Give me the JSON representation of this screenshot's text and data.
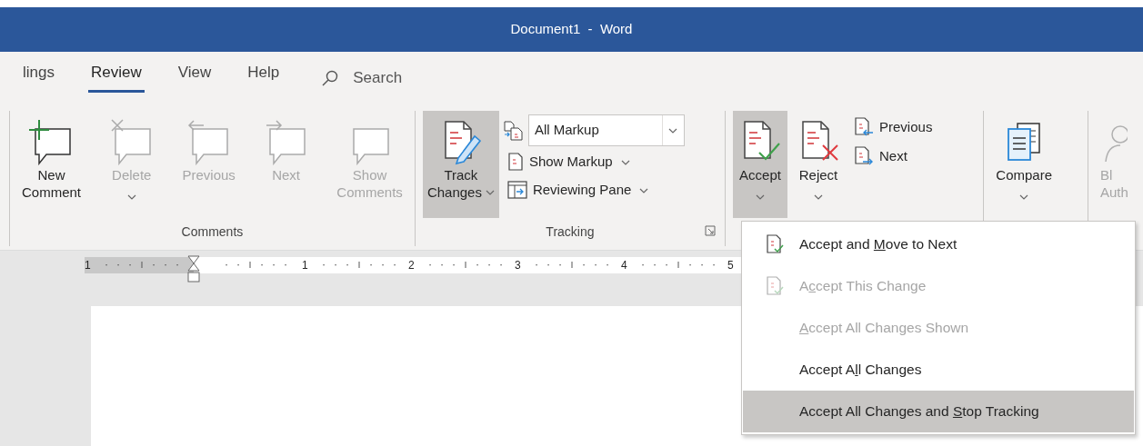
{
  "window": {
    "title": "Document1  -  Word"
  },
  "tabs": [
    {
      "label": "lings",
      "selected": false
    },
    {
      "label": "Review",
      "selected": true
    },
    {
      "label": "View",
      "selected": false
    },
    {
      "label": "Help",
      "selected": false
    }
  ],
  "search": {
    "placeholder": "Search"
  },
  "ribbon": {
    "groups": [
      {
        "label": "Comments",
        "dialog_launcher": false,
        "controls": [
          {
            "kind": "large",
            "label": [
              "New",
              "Comment"
            ],
            "disabled": false,
            "pressed": false,
            "dropdown": false
          },
          {
            "kind": "large",
            "label": [
              "Delete"
            ],
            "disabled": true,
            "pressed": false,
            "dropdown": true
          },
          {
            "kind": "large",
            "label": [
              "Previous"
            ],
            "disabled": true,
            "pressed": false,
            "dropdown": false
          },
          {
            "kind": "large",
            "label": [
              "Next"
            ],
            "disabled": true,
            "pressed": false,
            "dropdown": false
          },
          {
            "kind": "large",
            "label": [
              "Show",
              "Comments"
            ],
            "disabled": true,
            "pressed": false,
            "dropdown": false
          }
        ]
      },
      {
        "label": "Tracking",
        "dialog_launcher": true,
        "controls": [
          {
            "kind": "large",
            "label": [
              "Track",
              "Changes"
            ],
            "disabled": false,
            "pressed": true,
            "dropdown": true
          },
          {
            "kind": "stack",
            "items": [
              {
                "kind": "combo",
                "value": "All Markup"
              },
              {
                "kind": "small",
                "label": "Show Markup",
                "dropdown": true
              },
              {
                "kind": "small",
                "label": "Reviewing Pane",
                "dropdown": true
              }
            ]
          }
        ]
      },
      {
        "dialog_launcher": false,
        "controls": [
          {
            "kind": "large",
            "label": [
              "Accept"
            ],
            "disabled": false,
            "pressed": true,
            "dropdown": true
          },
          {
            "kind": "large",
            "label": [
              "Reject"
            ],
            "disabled": false,
            "pressed": false,
            "dropdown": true
          },
          {
            "kind": "stack",
            "items": [
              {
                "kind": "small",
                "label": "Previous",
                "dropdown": false
              },
              {
                "kind": "small",
                "label": "Next",
                "dropdown": false
              }
            ]
          }
        ]
      },
      {
        "dialog_launcher": false,
        "controls": [
          {
            "kind": "large",
            "label": [
              "Compare"
            ],
            "disabled": false,
            "pressed": false,
            "dropdown": true
          }
        ]
      },
      {
        "dialog_launcher": false,
        "controls": [
          {
            "kind": "large",
            "label": [
              "Bl",
              "Auth"
            ],
            "disabled": true,
            "pressed": false,
            "dropdown": false
          }
        ]
      }
    ]
  },
  "ruler": {
    "labels": [
      "1",
      "1",
      "2",
      "3",
      "4",
      "5"
    ]
  },
  "menu": {
    "items": [
      {
        "label": {
          "before": "Accept and ",
          "key": "M",
          "after": "ove to Next"
        },
        "has_icon": true,
        "disabled": false,
        "selected": false
      },
      {
        "label": {
          "before": "A",
          "key": "c",
          "after": "cept This Change"
        },
        "has_icon": true,
        "disabled": true,
        "selected": false
      },
      {
        "label": {
          "key": "A",
          "after": "ccept All Changes Shown"
        },
        "has_icon": false,
        "disabled": true,
        "selected": false
      },
      {
        "label": {
          "before": "Accept A",
          "key": "l",
          "after": "l Changes"
        },
        "has_icon": false,
        "disabled": false,
        "selected": false
      },
      {
        "label": {
          "before": "Accept All Changes and ",
          "key": "S",
          "after": "top Tracking"
        },
        "has_icon": false,
        "disabled": false,
        "selected": true
      }
    ]
  }
}
